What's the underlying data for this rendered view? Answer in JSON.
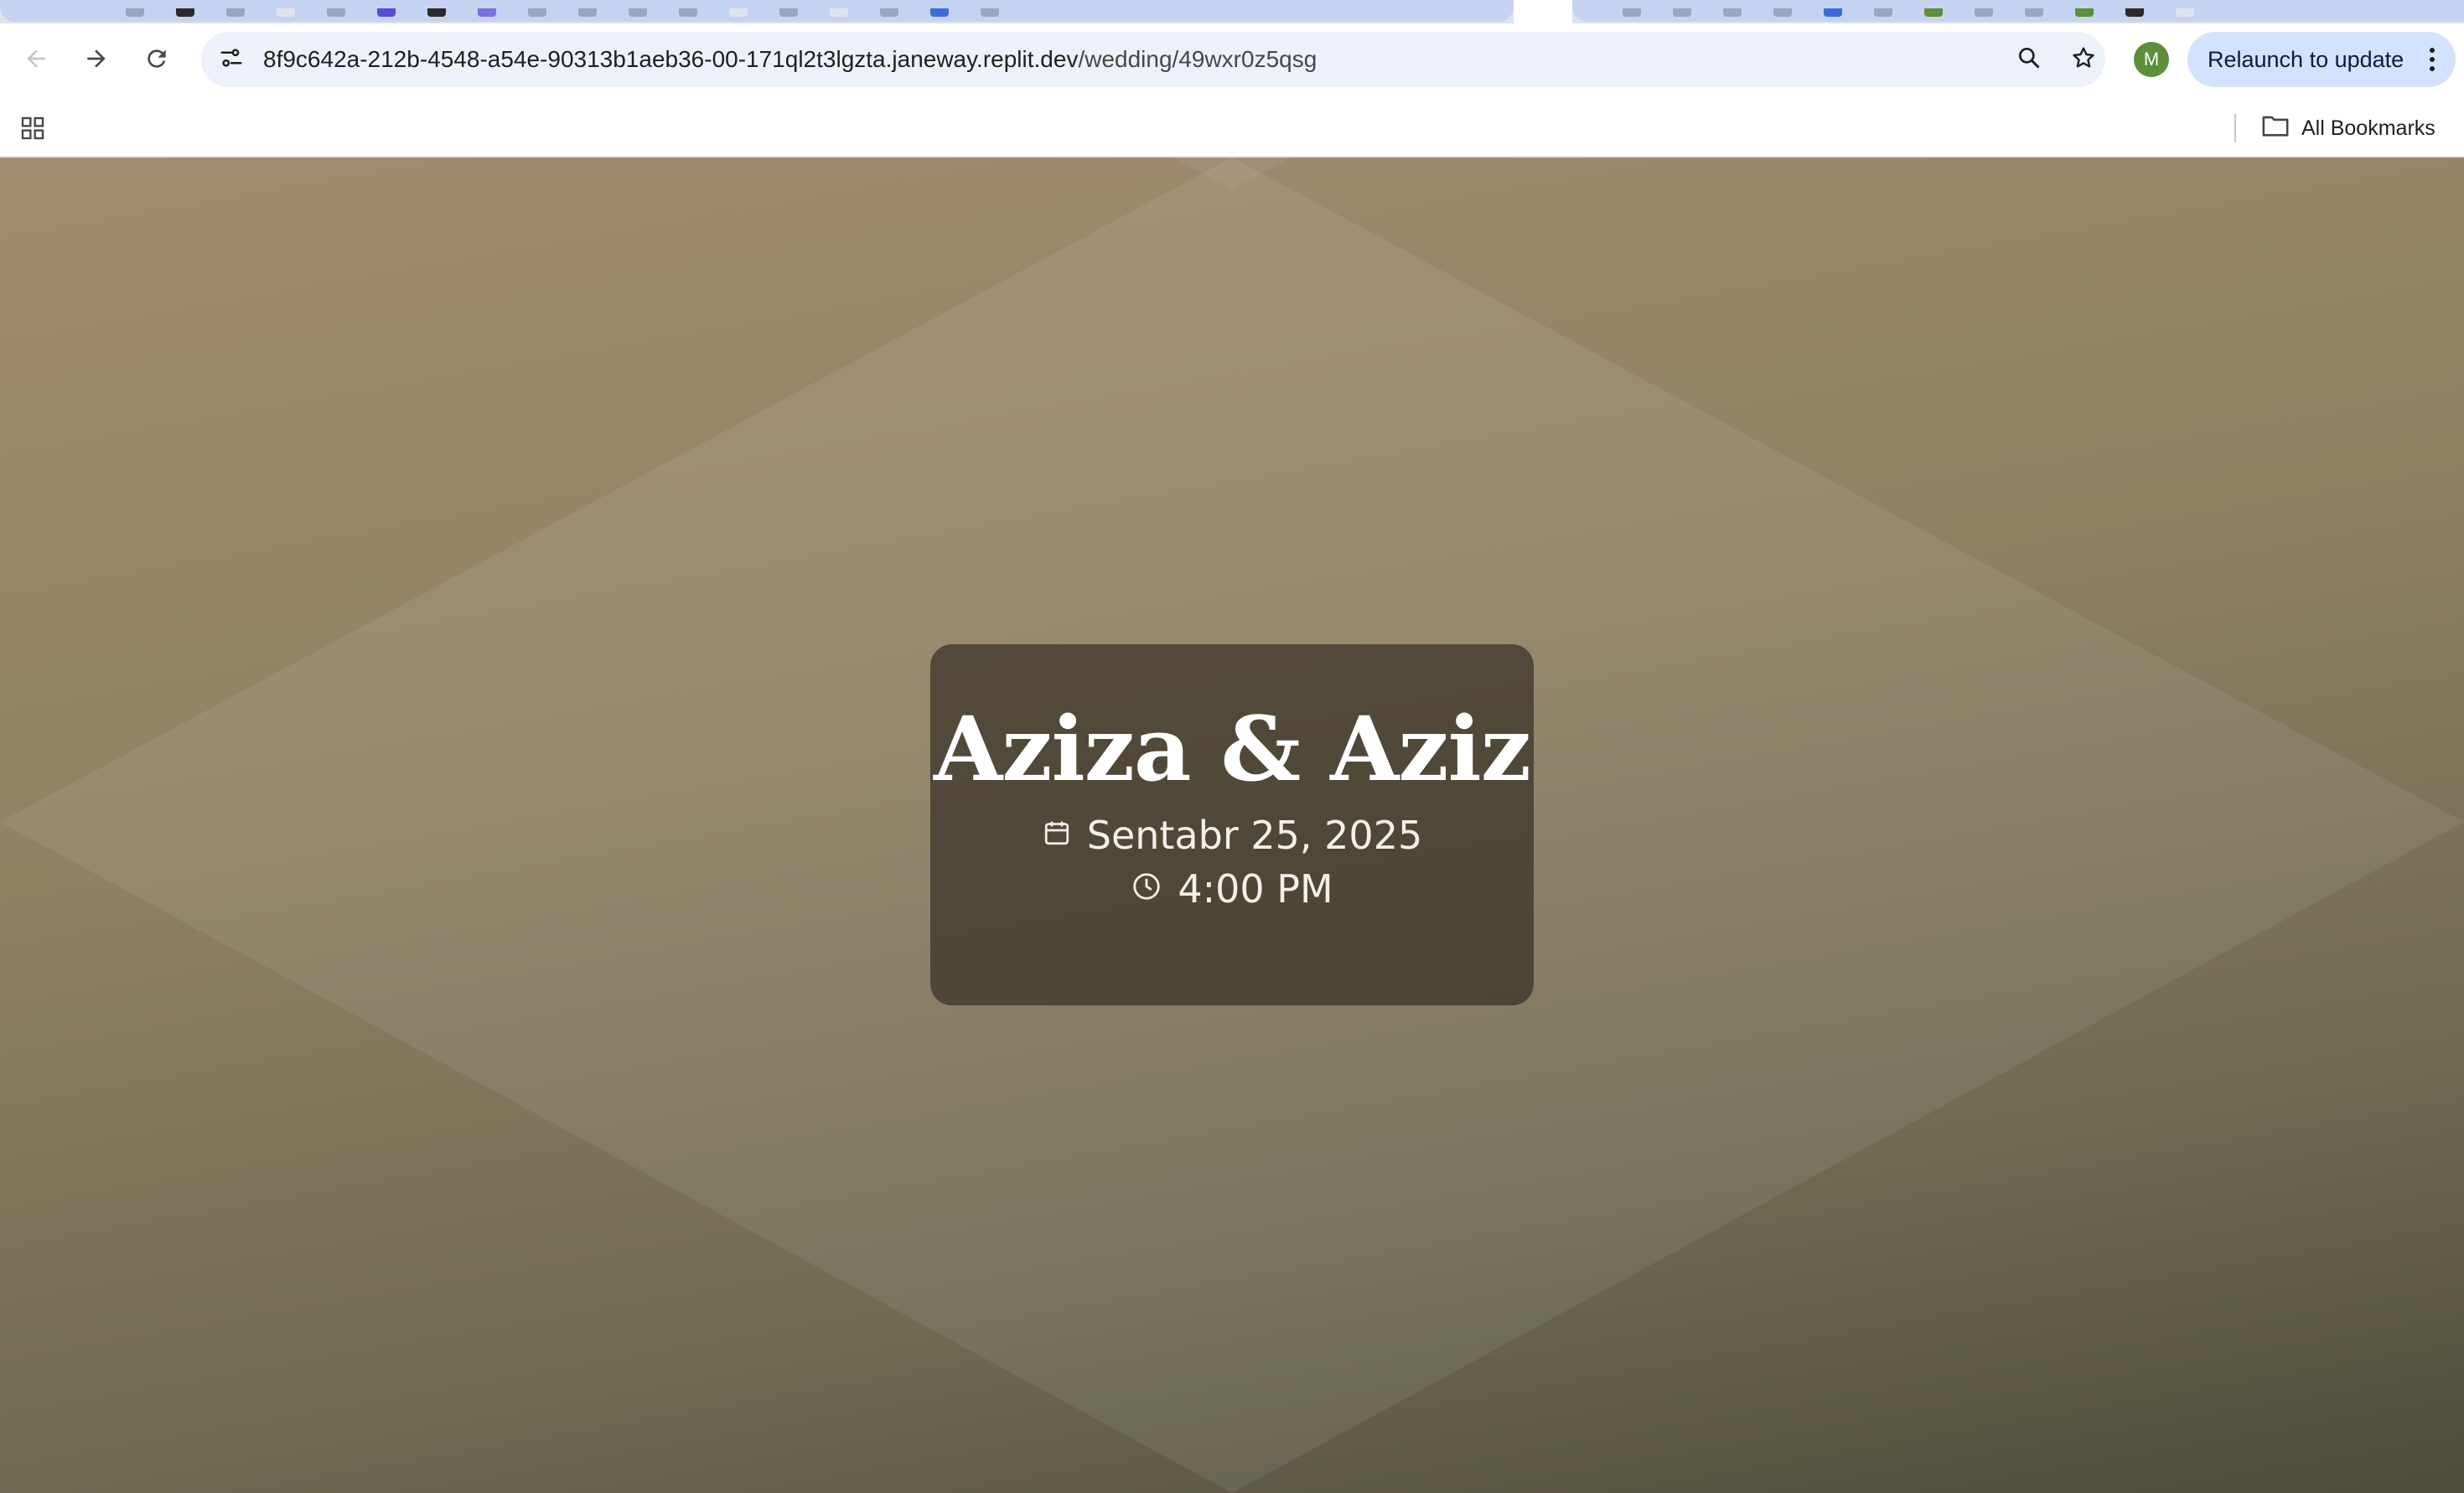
{
  "browser": {
    "url_host": "8f9c642a-212b-4548-a54e-90313b1aeb36-00-171ql2t3lgzta.janeway.replit.dev",
    "url_path": "/wedding/49wxr0z5qsg",
    "profile_initial": "M",
    "relaunch_label": "Relaunch to update",
    "all_bookmarks_label": "All Bookmarks",
    "icons": [
      "back-arrow-icon",
      "forward-arrow-icon",
      "reload-icon",
      "site-info-icon",
      "zoom-icon",
      "star-icon",
      "more-vert-icon",
      "apps-grid-icon",
      "folder-icon"
    ],
    "colors": {
      "tab_strip": "#dde3ea",
      "tab_group": "#c5d3f0",
      "omnibox": "#edf2fa",
      "relaunch_button": "#d3e3fd",
      "avatar": "#5b8f3a"
    }
  },
  "invitation": {
    "couple": "Aziza & Aziz",
    "date": "Sentabr 25, 2025",
    "time": "4:00 PM",
    "icons": [
      "calendar-icon",
      "clock-icon"
    ],
    "colors": {
      "background_top": "#a38b70",
      "background_bottom": "#4d4b3a",
      "card": "#373026"
    }
  }
}
